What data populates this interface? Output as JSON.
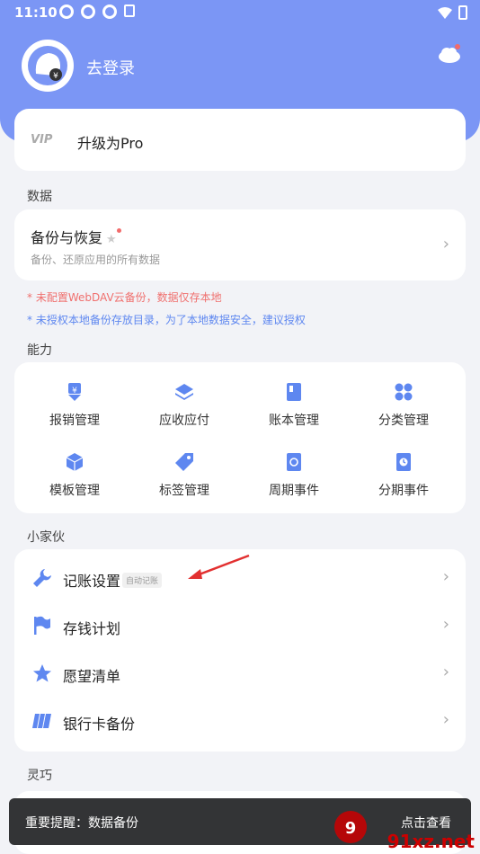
{
  "status": {
    "time": "11:10"
  },
  "user": {
    "login_label": "去登录"
  },
  "pro": {
    "logo_text": "VIP",
    "upgrade_label": "升级为Pro"
  },
  "sections": {
    "data": "数据",
    "abilities": "能力",
    "widgets": "小家伙",
    "smart": "灵巧"
  },
  "backup": {
    "title": "备份与恢复",
    "subtitle": "备份、还原应用的所有数据"
  },
  "notes": {
    "webdav": "* 未配置WebDAV云备份，数据仅存本地",
    "authorize": "* 未授权本地备份存放目录，为了本地数据安全，建议授权"
  },
  "abilities": [
    {
      "label": "报销管理",
      "icon": "reimburse-icon"
    },
    {
      "label": "应收应付",
      "icon": "layers-icon"
    },
    {
      "label": "账本管理",
      "icon": "book-icon"
    },
    {
      "label": "分类管理",
      "icon": "grid-icon"
    },
    {
      "label": "模板管理",
      "icon": "cube-icon"
    },
    {
      "label": "标签管理",
      "icon": "tag-icon"
    },
    {
      "label": "周期事件",
      "icon": "cycle-icon"
    },
    {
      "label": "分期事件",
      "icon": "installment-icon"
    }
  ],
  "widgets": [
    {
      "label": "记账设置",
      "badge": "自动记账",
      "icon": "wrench-icon"
    },
    {
      "label": "存钱计划",
      "icon": "flag-icon"
    },
    {
      "label": "愿望清单",
      "icon": "star-icon"
    },
    {
      "label": "银行卡备份",
      "icon": "card-icon"
    }
  ],
  "toast": {
    "message": "重要提醒：数据备份",
    "action": "点击查看"
  },
  "watermark": {
    "text": "91xz.net"
  },
  "colors": {
    "accent": "#7b96f5",
    "icon_blue": "#5e87f0",
    "warning_red": "#f0706e"
  }
}
